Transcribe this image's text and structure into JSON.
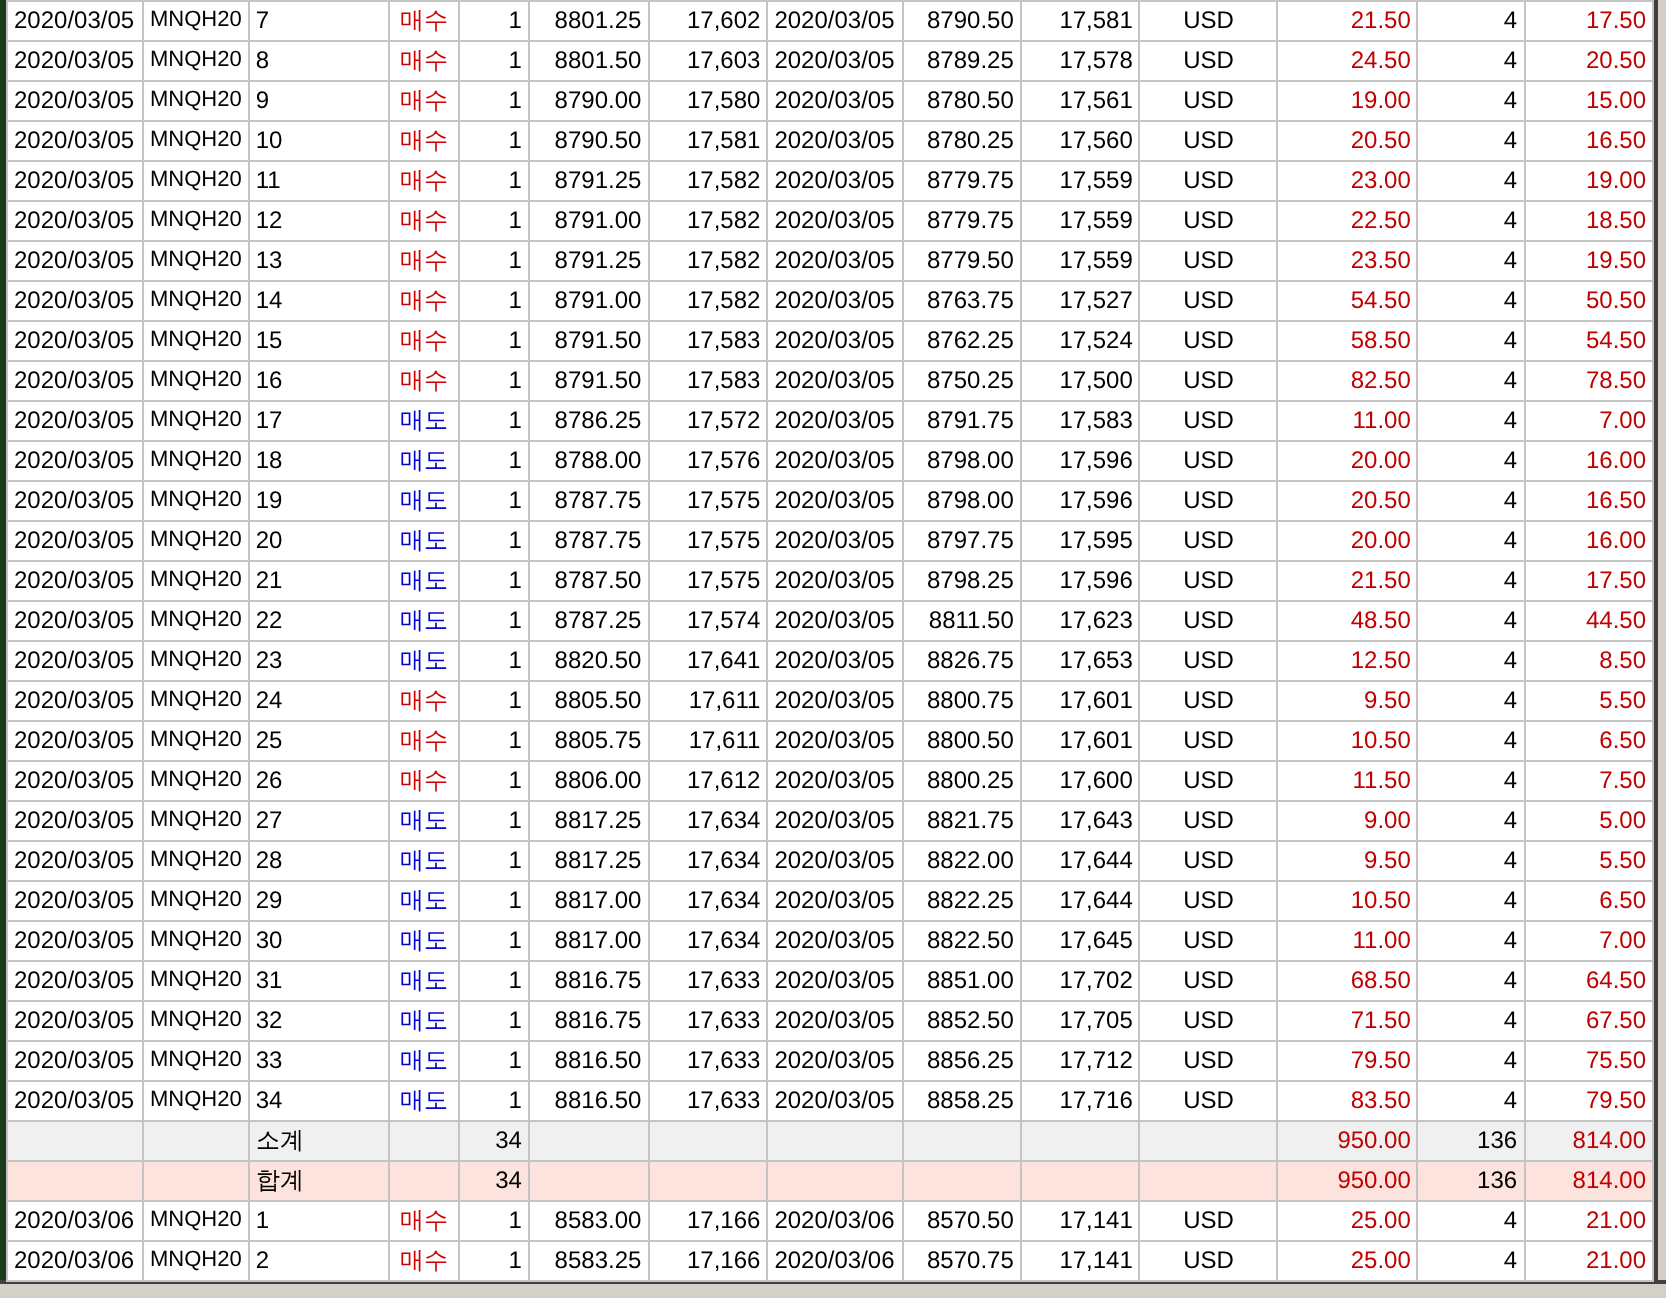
{
  "rows": [
    {
      "kind": "trade",
      "date": "2020/03/05",
      "code": "MNQH20",
      "no": "7",
      "side": "매수",
      "color": "#d00000",
      "qty": "1",
      "entry_price": "8801.25",
      "entry_value": "17,602",
      "exit_date": "2020/03/05",
      "exit_price": "8790.50",
      "exit_value": "17,581",
      "currency": "USD",
      "profit": "21.50",
      "count": "4",
      "net": "17.50"
    },
    {
      "kind": "trade",
      "date": "2020/03/05",
      "code": "MNQH20",
      "no": "8",
      "side": "매수",
      "color": "#d00000",
      "qty": "1",
      "entry_price": "8801.50",
      "entry_value": "17,603",
      "exit_date": "2020/03/05",
      "exit_price": "8789.25",
      "exit_value": "17,578",
      "currency": "USD",
      "profit": "24.50",
      "count": "4",
      "net": "20.50"
    },
    {
      "kind": "trade",
      "date": "2020/03/05",
      "code": "MNQH20",
      "no": "9",
      "side": "매수",
      "color": "#d00000",
      "qty": "1",
      "entry_price": "8790.00",
      "entry_value": "17,580",
      "exit_date": "2020/03/05",
      "exit_price": "8780.50",
      "exit_value": "17,561",
      "currency": "USD",
      "profit": "19.00",
      "count": "4",
      "net": "15.00"
    },
    {
      "kind": "trade",
      "date": "2020/03/05",
      "code": "MNQH20",
      "no": "10",
      "side": "매수",
      "color": "#d00000",
      "qty": "1",
      "entry_price": "8790.50",
      "entry_value": "17,581",
      "exit_date": "2020/03/05",
      "exit_price": "8780.25",
      "exit_value": "17,560",
      "currency": "USD",
      "profit": "20.50",
      "count": "4",
      "net": "16.50"
    },
    {
      "kind": "trade",
      "date": "2020/03/05",
      "code": "MNQH20",
      "no": "11",
      "side": "매수",
      "color": "#d00000",
      "qty": "1",
      "entry_price": "8791.25",
      "entry_value": "17,582",
      "exit_date": "2020/03/05",
      "exit_price": "8779.75",
      "exit_value": "17,559",
      "currency": "USD",
      "profit": "23.00",
      "count": "4",
      "net": "19.00"
    },
    {
      "kind": "trade",
      "date": "2020/03/05",
      "code": "MNQH20",
      "no": "12",
      "side": "매수",
      "color": "#d00000",
      "qty": "1",
      "entry_price": "8791.00",
      "entry_value": "17,582",
      "exit_date": "2020/03/05",
      "exit_price": "8779.75",
      "exit_value": "17,559",
      "currency": "USD",
      "profit": "22.50",
      "count": "4",
      "net": "18.50"
    },
    {
      "kind": "trade",
      "date": "2020/03/05",
      "code": "MNQH20",
      "no": "13",
      "side": "매수",
      "color": "#d00000",
      "qty": "1",
      "entry_price": "8791.25",
      "entry_value": "17,582",
      "exit_date": "2020/03/05",
      "exit_price": "8779.50",
      "exit_value": "17,559",
      "currency": "USD",
      "profit": "23.50",
      "count": "4",
      "net": "19.50"
    },
    {
      "kind": "trade",
      "date": "2020/03/05",
      "code": "MNQH20",
      "no": "14",
      "side": "매수",
      "color": "#d00000",
      "qty": "1",
      "entry_price": "8791.00",
      "entry_value": "17,582",
      "exit_date": "2020/03/05",
      "exit_price": "8763.75",
      "exit_value": "17,527",
      "currency": "USD",
      "profit": "54.50",
      "count": "4",
      "net": "50.50"
    },
    {
      "kind": "trade",
      "date": "2020/03/05",
      "code": "MNQH20",
      "no": "15",
      "side": "매수",
      "color": "#d00000",
      "qty": "1",
      "entry_price": "8791.50",
      "entry_value": "17,583",
      "exit_date": "2020/03/05",
      "exit_price": "8762.25",
      "exit_value": "17,524",
      "currency": "USD",
      "profit": "58.50",
      "count": "4",
      "net": "54.50"
    },
    {
      "kind": "trade",
      "date": "2020/03/05",
      "code": "MNQH20",
      "no": "16",
      "side": "매수",
      "color": "#d00000",
      "qty": "1",
      "entry_price": "8791.50",
      "entry_value": "17,583",
      "exit_date": "2020/03/05",
      "exit_price": "8750.25",
      "exit_value": "17,500",
      "currency": "USD",
      "profit": "82.50",
      "count": "4",
      "net": "78.50"
    },
    {
      "kind": "trade",
      "date": "2020/03/05",
      "code": "MNQH20",
      "no": "17",
      "side": "매도",
      "color": "#0000d0",
      "qty": "1",
      "entry_price": "8786.25",
      "entry_value": "17,572",
      "exit_date": "2020/03/05",
      "exit_price": "8791.75",
      "exit_value": "17,583",
      "currency": "USD",
      "profit": "11.00",
      "count": "4",
      "net": "7.00"
    },
    {
      "kind": "trade",
      "date": "2020/03/05",
      "code": "MNQH20",
      "no": "18",
      "side": "매도",
      "color": "#0000d0",
      "qty": "1",
      "entry_price": "8788.00",
      "entry_value": "17,576",
      "exit_date": "2020/03/05",
      "exit_price": "8798.00",
      "exit_value": "17,596",
      "currency": "USD",
      "profit": "20.00",
      "count": "4",
      "net": "16.00"
    },
    {
      "kind": "trade",
      "date": "2020/03/05",
      "code": "MNQH20",
      "no": "19",
      "side": "매도",
      "color": "#0000d0",
      "qty": "1",
      "entry_price": "8787.75",
      "entry_value": "17,575",
      "exit_date": "2020/03/05",
      "exit_price": "8798.00",
      "exit_value": "17,596",
      "currency": "USD",
      "profit": "20.50",
      "count": "4",
      "net": "16.50"
    },
    {
      "kind": "trade",
      "date": "2020/03/05",
      "code": "MNQH20",
      "no": "20",
      "side": "매도",
      "color": "#0000d0",
      "qty": "1",
      "entry_price": "8787.75",
      "entry_value": "17,575",
      "exit_date": "2020/03/05",
      "exit_price": "8797.75",
      "exit_value": "17,595",
      "currency": "USD",
      "profit": "20.00",
      "count": "4",
      "net": "16.00"
    },
    {
      "kind": "trade",
      "date": "2020/03/05",
      "code": "MNQH20",
      "no": "21",
      "side": "매도",
      "color": "#0000d0",
      "qty": "1",
      "entry_price": "8787.50",
      "entry_value": "17,575",
      "exit_date": "2020/03/05",
      "exit_price": "8798.25",
      "exit_value": "17,596",
      "currency": "USD",
      "profit": "21.50",
      "count": "4",
      "net": "17.50"
    },
    {
      "kind": "trade",
      "date": "2020/03/05",
      "code": "MNQH20",
      "no": "22",
      "side": "매도",
      "color": "#0000d0",
      "qty": "1",
      "entry_price": "8787.25",
      "entry_value": "17,574",
      "exit_date": "2020/03/05",
      "exit_price": "8811.50",
      "exit_value": "17,623",
      "currency": "USD",
      "profit": "48.50",
      "count": "4",
      "net": "44.50"
    },
    {
      "kind": "trade",
      "date": "2020/03/05",
      "code": "MNQH20",
      "no": "23",
      "side": "매도",
      "color": "#0000d0",
      "qty": "1",
      "entry_price": "8820.50",
      "entry_value": "17,641",
      "exit_date": "2020/03/05",
      "exit_price": "8826.75",
      "exit_value": "17,653",
      "currency": "USD",
      "profit": "12.50",
      "count": "4",
      "net": "8.50"
    },
    {
      "kind": "trade",
      "date": "2020/03/05",
      "code": "MNQH20",
      "no": "24",
      "side": "매수",
      "color": "#d00000",
      "qty": "1",
      "entry_price": "8805.50",
      "entry_value": "17,611",
      "exit_date": "2020/03/05",
      "exit_price": "8800.75",
      "exit_value": "17,601",
      "currency": "USD",
      "profit": "9.50",
      "count": "4",
      "net": "5.50"
    },
    {
      "kind": "trade",
      "date": "2020/03/05",
      "code": "MNQH20",
      "no": "25",
      "side": "매수",
      "color": "#d00000",
      "qty": "1",
      "entry_price": "8805.75",
      "entry_value": "17,611",
      "exit_date": "2020/03/05",
      "exit_price": "8800.50",
      "exit_value": "17,601",
      "currency": "USD",
      "profit": "10.50",
      "count": "4",
      "net": "6.50"
    },
    {
      "kind": "trade",
      "date": "2020/03/05",
      "code": "MNQH20",
      "no": "26",
      "side": "매수",
      "color": "#d00000",
      "qty": "1",
      "entry_price": "8806.00",
      "entry_value": "17,612",
      "exit_date": "2020/03/05",
      "exit_price": "8800.25",
      "exit_value": "17,600",
      "currency": "USD",
      "profit": "11.50",
      "count": "4",
      "net": "7.50"
    },
    {
      "kind": "trade",
      "date": "2020/03/05",
      "code": "MNQH20",
      "no": "27",
      "side": "매도",
      "color": "#0000d0",
      "qty": "1",
      "entry_price": "8817.25",
      "entry_value": "17,634",
      "exit_date": "2020/03/05",
      "exit_price": "8821.75",
      "exit_value": "17,643",
      "currency": "USD",
      "profit": "9.00",
      "count": "4",
      "net": "5.00"
    },
    {
      "kind": "trade",
      "date": "2020/03/05",
      "code": "MNQH20",
      "no": "28",
      "side": "매도",
      "color": "#0000d0",
      "qty": "1",
      "entry_price": "8817.25",
      "entry_value": "17,634",
      "exit_date": "2020/03/05",
      "exit_price": "8822.00",
      "exit_value": "17,644",
      "currency": "USD",
      "profit": "9.50",
      "count": "4",
      "net": "5.50"
    },
    {
      "kind": "trade",
      "date": "2020/03/05",
      "code": "MNQH20",
      "no": "29",
      "side": "매도",
      "color": "#0000d0",
      "qty": "1",
      "entry_price": "8817.00",
      "entry_value": "17,634",
      "exit_date": "2020/03/05",
      "exit_price": "8822.25",
      "exit_value": "17,644",
      "currency": "USD",
      "profit": "10.50",
      "count": "4",
      "net": "6.50"
    },
    {
      "kind": "trade",
      "date": "2020/03/05",
      "code": "MNQH20",
      "no": "30",
      "side": "매도",
      "color": "#0000d0",
      "qty": "1",
      "entry_price": "8817.00",
      "entry_value": "17,634",
      "exit_date": "2020/03/05",
      "exit_price": "8822.50",
      "exit_value": "17,645",
      "currency": "USD",
      "profit": "11.00",
      "count": "4",
      "net": "7.00"
    },
    {
      "kind": "trade",
      "date": "2020/03/05",
      "code": "MNQH20",
      "no": "31",
      "side": "매도",
      "color": "#0000d0",
      "qty": "1",
      "entry_price": "8816.75",
      "entry_value": "17,633",
      "exit_date": "2020/03/05",
      "exit_price": "8851.00",
      "exit_value": "17,702",
      "currency": "USD",
      "profit": "68.50",
      "count": "4",
      "net": "64.50"
    },
    {
      "kind": "trade",
      "date": "2020/03/05",
      "code": "MNQH20",
      "no": "32",
      "side": "매도",
      "color": "#0000d0",
      "qty": "1",
      "entry_price": "8816.75",
      "entry_value": "17,633",
      "exit_date": "2020/03/05",
      "exit_price": "8852.50",
      "exit_value": "17,705",
      "currency": "USD",
      "profit": "71.50",
      "count": "4",
      "net": "67.50"
    },
    {
      "kind": "trade",
      "date": "2020/03/05",
      "code": "MNQH20",
      "no": "33",
      "side": "매도",
      "color": "#0000d0",
      "qty": "1",
      "entry_price": "8816.50",
      "entry_value": "17,633",
      "exit_date": "2020/03/05",
      "exit_price": "8856.25",
      "exit_value": "17,712",
      "currency": "USD",
      "profit": "79.50",
      "count": "4",
      "net": "75.50"
    },
    {
      "kind": "trade",
      "date": "2020/03/05",
      "code": "MNQH20",
      "no": "34",
      "side": "매도",
      "color": "#0000d0",
      "qty": "1",
      "entry_price": "8816.50",
      "entry_value": "17,633",
      "exit_date": "2020/03/05",
      "exit_price": "8858.25",
      "exit_value": "17,716",
      "currency": "USD",
      "profit": "83.50",
      "count": "4",
      "net": "79.50"
    },
    {
      "kind": "subtotal",
      "no": "소계",
      "qty": "34",
      "profit": "950.00",
      "count": "136",
      "net": "814.00"
    },
    {
      "kind": "total",
      "no": "합계",
      "qty": "34",
      "profit": "950.00",
      "count": "136",
      "net": "814.00"
    },
    {
      "kind": "trade",
      "date": "2020/03/06",
      "code": "MNQH20",
      "no": "1",
      "side": "매수",
      "color": "#d00000",
      "qty": "1",
      "entry_price": "8583.00",
      "entry_value": "17,166",
      "exit_date": "2020/03/06",
      "exit_price": "8570.50",
      "exit_value": "17,141",
      "currency": "USD",
      "profit": "25.00",
      "count": "4",
      "net": "21.00"
    },
    {
      "kind": "trade",
      "date": "2020/03/06",
      "code": "MNQH20",
      "no": "2",
      "side": "매수",
      "color": "#d00000",
      "qty": "1",
      "entry_price": "8583.25",
      "entry_value": "17,166",
      "exit_date": "2020/03/06",
      "exit_price": "8570.75",
      "exit_value": "17,141",
      "currency": "USD",
      "profit": "25.00",
      "count": "4",
      "net": "21.00"
    }
  ]
}
